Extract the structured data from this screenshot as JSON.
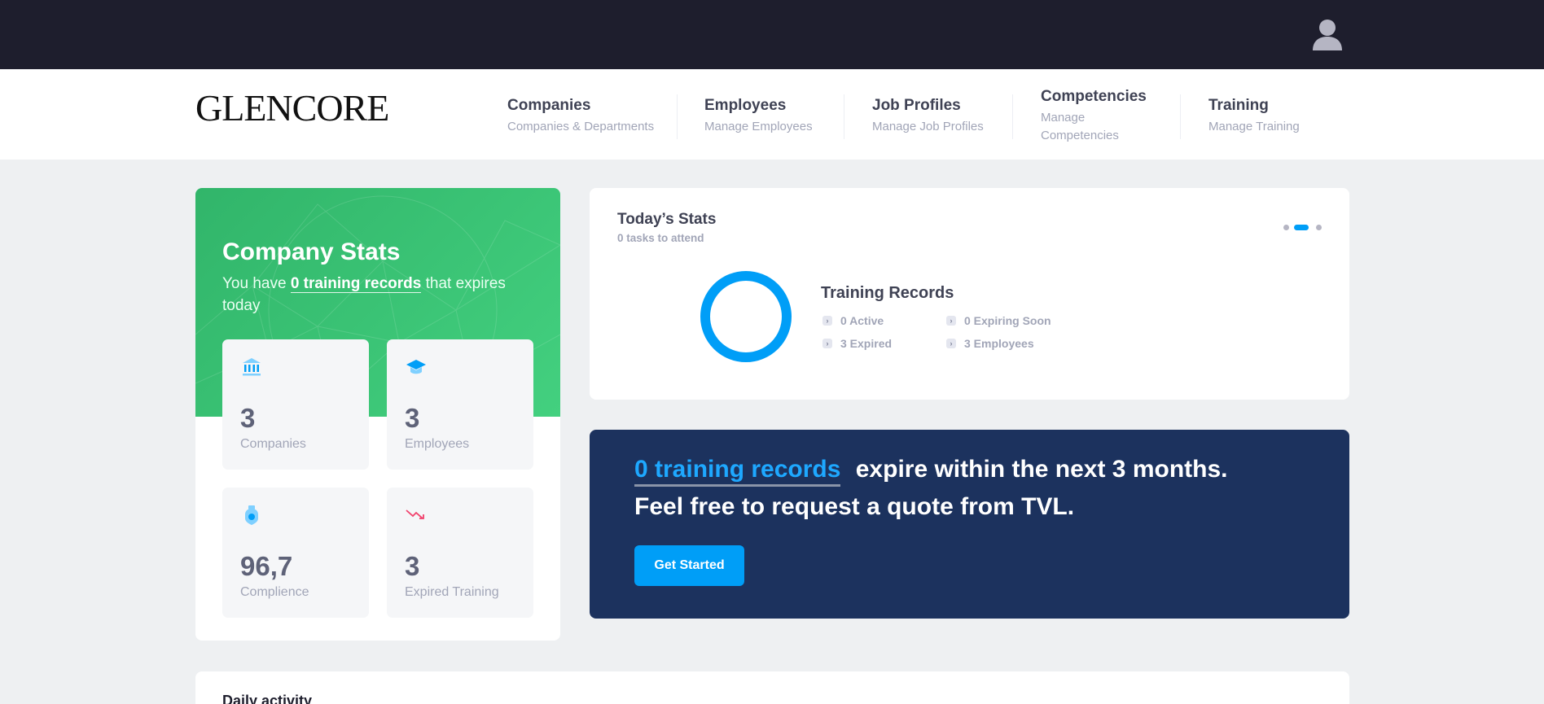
{
  "header": {
    "avatar_icon": "user-avatar-icon"
  },
  "brand": {
    "logo_text": "GLENCORE"
  },
  "nav": [
    {
      "title": "Companies",
      "subtitle": "Companies & Departments"
    },
    {
      "title": "Employees",
      "subtitle": "Manage Employees"
    },
    {
      "title": "Job Profiles",
      "subtitle": "Manage Job Profiles"
    },
    {
      "title": "Competencies",
      "subtitle": "Manage Competencies"
    },
    {
      "title": "Training",
      "subtitle": "Manage Training"
    }
  ],
  "company_stats": {
    "title": "Company Stats",
    "text_before": "You have ",
    "highlight": "0 training records",
    "text_after": " that expires today",
    "tiles": [
      {
        "icon": "bank-icon",
        "value": "3",
        "label": "Companies"
      },
      {
        "icon": "graduation-cap-icon",
        "value": "3",
        "label": "Employees"
      },
      {
        "icon": "shield-badge-icon",
        "value": "96,7",
        "label": "Complience"
      },
      {
        "icon": "trend-down-icon",
        "value": "3",
        "label": "Expired Training"
      }
    ]
  },
  "todays_stats": {
    "title": "Today’s Stats",
    "subtitle": "0 tasks to attend",
    "carousel_active_index": 1,
    "records_title": "Training Records",
    "items": [
      {
        "label": "0 Active"
      },
      {
        "label": "0 Expiring Soon"
      },
      {
        "label": "3 Expired"
      },
      {
        "label": "3 Employees"
      }
    ]
  },
  "cta": {
    "highlight": "0 training records",
    "line1_rest": "expire within the next 3 months.",
    "line2": "Feel free to request a quote from TVL.",
    "button_label": "Get Started"
  },
  "daily": {
    "title": "Daily activity"
  },
  "colors": {
    "topbar": "#1e1e2d",
    "green": "#3cc677",
    "primary": "#009ef7",
    "navy": "#1c325e",
    "background": "#eef0f2"
  }
}
